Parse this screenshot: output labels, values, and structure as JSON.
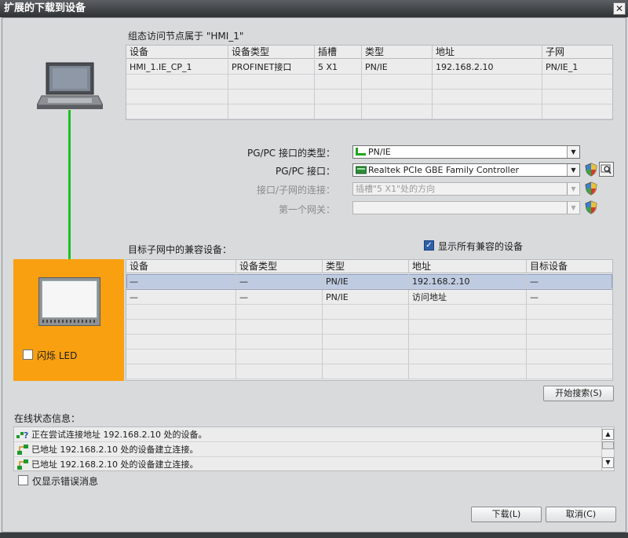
{
  "window": {
    "title": "扩展的下载到设备",
    "close_label": "✕"
  },
  "configured": {
    "heading": "组态访问节点属于 \"HMI_1\"",
    "columns": [
      "设备",
      "设备类型",
      "插槽",
      "类型",
      "地址",
      "子网"
    ],
    "rows": [
      [
        "HMI_1.IE_CP_1",
        "PROFINET接口",
        "5 X1",
        "PN/IE",
        "192.168.2.10",
        "PN/IE_1"
      ]
    ]
  },
  "interface": {
    "type_label": "PG/PC 接口的类型：",
    "type_value": "PN/IE",
    "iface_label": "PG/PC 接口：",
    "iface_value": "Realtek PCIe GBE Family Controller",
    "conn_label": "接口/子网的连接：",
    "conn_value": "插槽\"5 X1\"处的方向",
    "gateway_label": "第一个网关：",
    "gateway_value": ""
  },
  "compatible": {
    "heading": "目标子网中的兼容设备：",
    "show_all_label": "显示所有兼容的设备",
    "show_all_checked": true,
    "columns": [
      "设备",
      "设备类型",
      "类型",
      "地址",
      "目标设备"
    ],
    "rows": [
      [
        "—",
        "—",
        "PN/IE",
        "192.168.2.10",
        "—"
      ],
      [
        "—",
        "—",
        "PN/IE",
        "访问地址",
        "—"
      ]
    ]
  },
  "target": {
    "flash_led_label": "闪烁 LED"
  },
  "buttons": {
    "search": "开始搜索(S)",
    "download": "下载(L)",
    "cancel": "取消(C)"
  },
  "status": {
    "heading": "在线状态信息：",
    "messages": [
      "正在尝试连接地址 192.168.2.10 处的设备。",
      "已地址 192.168.2.10 处的设备建立连接。",
      "已地址 192.168.2.10 处的设备建立连接。"
    ],
    "errors_only_label": "仅显示错误消息"
  },
  "colors": {
    "accent_orange": "#f9a010",
    "link_green": "#18c21f",
    "title_bar": "#2f3235",
    "selection": "#bfcbe0"
  },
  "icons": [
    "pc-station-icon",
    "hmi-panel-icon",
    "network-adapter-icon",
    "shield-icon",
    "search-icon",
    "connecting-icon",
    "connected-icon"
  ]
}
